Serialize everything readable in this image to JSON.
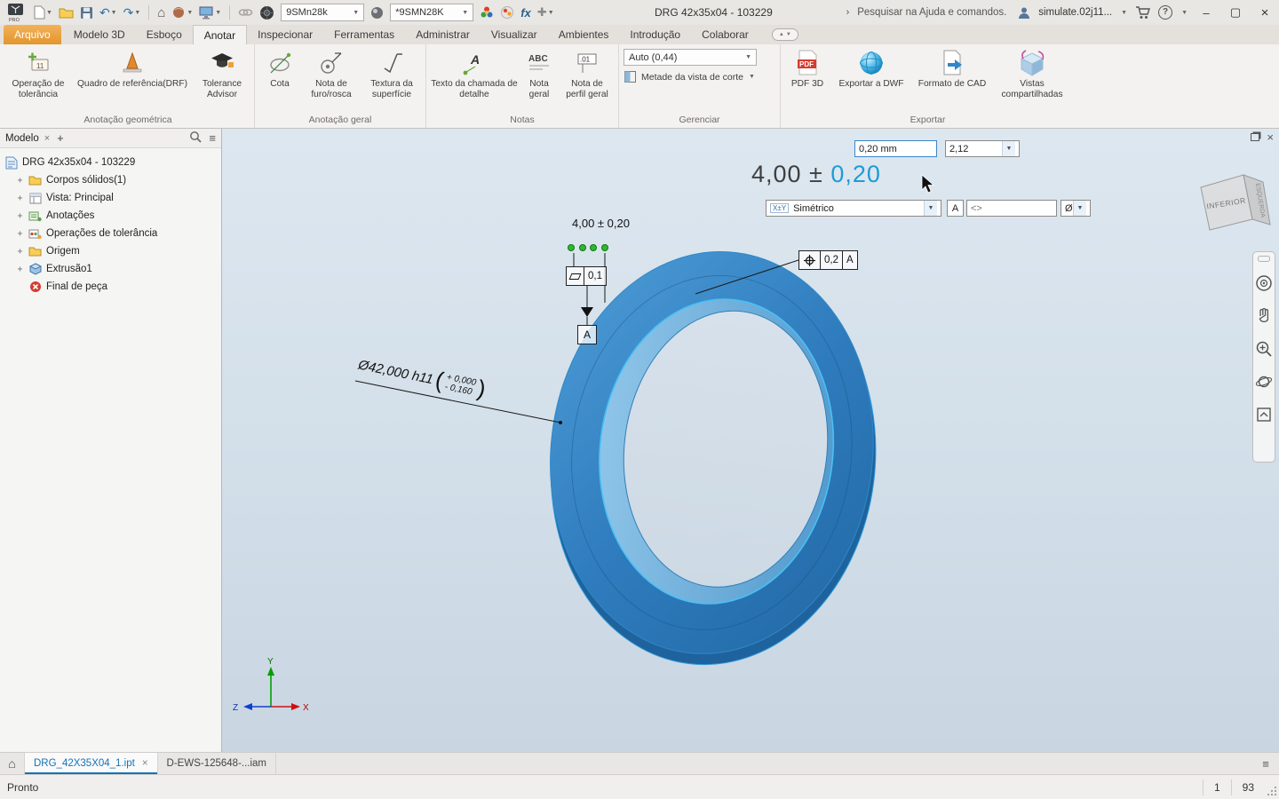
{
  "accents": {
    "highlight_blue": "#1f9bd6",
    "grip_green": "#2db82d",
    "ring_blue": "#2e7cc0",
    "file_tab_orange": "#e2952d",
    "active_tab_blue": "#1273b8"
  },
  "titlebar": {
    "logo_text": "PRO",
    "material_combo": "9SMn28k",
    "appearance_combo": "*9SMN28K",
    "fx_label": "fx",
    "doc_title": "DRG 42x35x04  -  103229",
    "search_placeholder": "Pesquisar na Ajuda e comandos.",
    "user_name": "simulate.02j11...",
    "help_label": "?"
  },
  "ribbon_tabs": {
    "file": "Arquivo",
    "items": [
      "Modelo 3D",
      "Esboço",
      "Anotar",
      "Inspecionar",
      "Ferramentas",
      "Administrar",
      "Visualizar",
      "Ambientes",
      "Introdução",
      "Colaborar"
    ]
  },
  "ribbon": {
    "g1": {
      "label": "Anotação geométrica",
      "b1": "Operação de tolerância",
      "b2": "Quadro de referência(DRF)",
      "b3": "Tolerance Advisor"
    },
    "g2": {
      "label": "Anotação geral",
      "b1": "Cota",
      "b2": "Nota de furo/rosca",
      "b3": "Textura da superfície"
    },
    "g3": {
      "label": "Notas",
      "b1": "Texto da chamada de detalhe",
      "b2": "Nota geral",
      "b3": "Nota de perfil geral"
    },
    "g4": {
      "label": "Gerenciar",
      "combo": "Auto (0,44)",
      "toggle": "Metade da vista de corte"
    },
    "g5": {
      "label": "Exportar",
      "b1": "PDF 3D",
      "b2": "Exportar a DWF",
      "b3": "Formato de CAD",
      "b4": "Vistas compartilhadas"
    }
  },
  "browser": {
    "tab_label": "Modelo",
    "items": [
      "DRG 42x35x04  -  103229",
      "Corpos sólidos(1)",
      "Vista: Principal",
      "Anotações",
      "Operações de tolerância",
      "Origem",
      "Extrusão1",
      "Final de peça"
    ]
  },
  "viewport": {
    "edit": {
      "value_box": "0,20 mm",
      "ratio_box": "2,12",
      "dim_prefix": "4,00 ±",
      "dim_value": "0,20",
      "tol_icon": "X±Y",
      "tol_type": "Simétrico",
      "datum_btn": "A",
      "field_value": "<>",
      "dia_btn": "Ø"
    },
    "ann": {
      "linear_dim": "4,00 ± 0,20",
      "flatness_value": "0,1",
      "datum_label": "A",
      "pos_value": "0,2",
      "pos_datum": "A",
      "dia_dim": "Ø42,000 h11",
      "tol_upper": "+ 0,000",
      "tol_lower": "- 0,160"
    },
    "viewcube": {
      "face_front": "INFERIOR",
      "face_side": "ESQUERDA"
    },
    "triad": {
      "x": "X",
      "y": "Y",
      "z": "Z"
    }
  },
  "doc_tabs": {
    "tab1": "DRG_42X35X04_1.ipt",
    "tab2": "D-EWS-125648-...iam"
  },
  "statusbar": {
    "ready": "Pronto",
    "n1": "1",
    "n2": "93"
  }
}
